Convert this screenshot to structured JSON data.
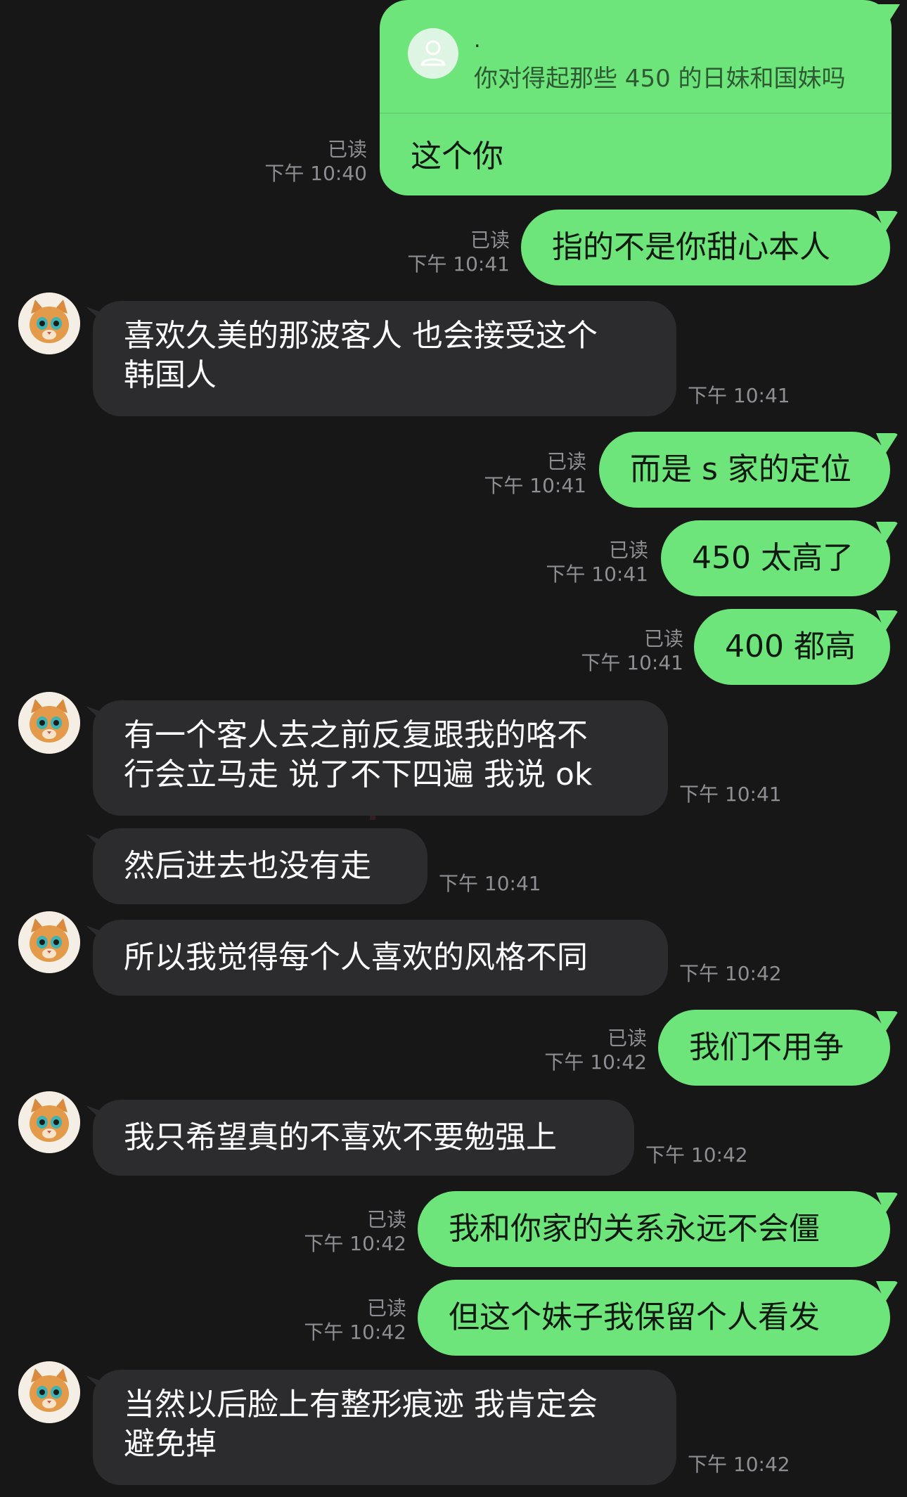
{
  "quoted_message": {
    "sender": ".",
    "text": "你对得起那些 450 的日妹和国妹吗",
    "reply": "这个你",
    "read": "已读",
    "time": "下午 10:40"
  },
  "messages": [
    {
      "id": "m1",
      "dir": "out",
      "text": "指的不是你甜心本人",
      "read": "已读",
      "time": "下午 10:41"
    },
    {
      "id": "m2",
      "dir": "in",
      "lines": [
        "喜欢久美的那波客人 也会接受这个",
        "韩国人"
      ],
      "time": "下午 10:41"
    },
    {
      "id": "m3",
      "dir": "out",
      "text": "而是 s 家的定位",
      "read": "已读",
      "time": "下午 10:41"
    },
    {
      "id": "m4",
      "dir": "out",
      "text": "450 太高了",
      "read": "已读",
      "time": "下午 10:41"
    },
    {
      "id": "m5",
      "dir": "out",
      "text": "400 都高",
      "read": "已读",
      "time": "下午 10:41"
    },
    {
      "id": "m6",
      "dir": "in",
      "lines": [
        "有一个客人去之前反复跟我的咯不",
        "行会立马走 说了不下四遍 我说 ok"
      ],
      "time": "下午 10:41"
    },
    {
      "id": "m7",
      "dir": "in",
      "text": "然后进去也没有走",
      "time": "下午 10:41"
    },
    {
      "id": "m8",
      "dir": "in",
      "text": "所以我觉得每个人喜欢的风格不同",
      "time": "下午 10:42"
    },
    {
      "id": "m9",
      "dir": "out",
      "text": "我们不用争",
      "read": "已读",
      "time": "下午 10:42"
    },
    {
      "id": "m10",
      "dir": "in",
      "text": "我只希望真的不喜欢不要勉强上",
      "time": "下午 10:42"
    },
    {
      "id": "m11",
      "dir": "out",
      "text": "我和你家的关系永远不会僵",
      "read": "已读",
      "time": "下午 10:42"
    },
    {
      "id": "m12",
      "dir": "out",
      "text": "但这个妹子我保留个人看发",
      "read": "已读",
      "time": "下午 10:42"
    },
    {
      "id": "m13",
      "dir": "in",
      "lines": [
        "当然以后脸上有整形痕迹 我肯定会",
        "避免掉"
      ],
      "time": "下午 10:42"
    }
  ],
  "colors": {
    "background": "#171717",
    "outgoing": "#6de57a",
    "incoming": "#2c2c2e",
    "meta": "#8e8e93"
  },
  "icons": {
    "avatar": "cat-avatar-icon",
    "quote_avatar": "user-silhouette-icon"
  }
}
